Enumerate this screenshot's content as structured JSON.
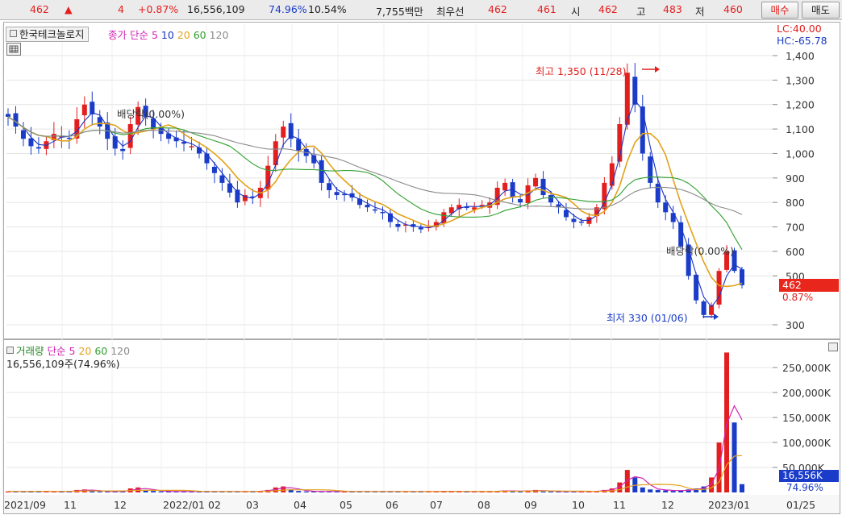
{
  "quote": {
    "price": "462",
    "arrow": "▲",
    "change": "4",
    "change_pct": "+0.87%",
    "volume": "16,556,109",
    "volume_ratio": "74.96%",
    "turnover": "10.54%",
    "amount": "7,755백만",
    "best_label": "최우선",
    "ask": "462",
    "bid": "461",
    "open_label": "시",
    "open": "462",
    "high_label": "고",
    "high": "483",
    "low_label": "저",
    "low": "460",
    "buy_label": "매수",
    "sell_label": "매도"
  },
  "price_panel": {
    "stock_name": "한국테크놀로지",
    "legend_prefix": "종가 단순",
    "ma_labels": [
      "5",
      "10",
      "20",
      "60",
      "120"
    ],
    "ma_colors": [
      "#1b35c4",
      "#e2a21a",
      "#2fa02f",
      "#8a8a8a"
    ],
    "lc_label": "LC:40.00",
    "hc_label": "HC:-65.78",
    "current_price": "462",
    "current_pct": "0.87%",
    "high_annotation": "최고 1,350 (11/28)",
    "low_annotation": "최저 330 (01/06)",
    "dividend_label_1": "배당락(0.00%)",
    "dividend_label_2": "배당락(0.00%)"
  },
  "volume_panel": {
    "legend_title": "거래량",
    "legend_prefix": "단순",
    "ma_labels": [
      "5",
      "20",
      "60",
      "120"
    ],
    "summary": "16,556,109주(74.96%)",
    "current_volume": "16,556K",
    "current_ratio": "74.96%"
  },
  "colors": {
    "up": "#e31e1e",
    "down": "#1a3cc8",
    "accent": "#e8261c"
  },
  "chart_data": [
    {
      "type": "candlestick",
      "title": "한국테크놀로지",
      "y_ticks": [
        "1,400",
        "1,300",
        "1,200",
        "1,100",
        "1,000",
        "900",
        "800",
        "700",
        "600",
        "500",
        "300"
      ],
      "ylim": [
        270,
        1420
      ],
      "x_ticks": [
        "2021/09",
        "11",
        "12",
        "2022/01",
        "02",
        "03",
        "04",
        "05",
        "06",
        "07",
        "08",
        "09",
        "10",
        "11",
        "12",
        "2023/01",
        "01/25"
      ],
      "close": [
        1150,
        1110,
        1060,
        1030,
        1020,
        1050,
        1080,
        1070,
        1060,
        1140,
        1200,
        1160,
        1110,
        1060,
        1020,
        1010,
        1120,
        1190,
        1150,
        1100,
        1080,
        1060,
        1050,
        1040,
        1030,
        1000,
        960,
        920,
        880,
        840,
        800,
        830,
        820,
        860,
        950,
        1050,
        1110,
        1060,
        1010,
        990,
        960,
        880,
        850,
        830,
        830,
        820,
        790,
        780,
        770,
        760,
        720,
        700,
        710,
        700,
        690,
        700,
        720,
        760,
        780,
        790,
        780,
        780,
        790,
        800,
        860,
        880,
        820,
        800,
        870,
        900,
        830,
        800,
        780,
        740,
        720,
        720,
        740,
        780,
        880,
        960,
        1120,
        1330,
        1200,
        1000,
        880,
        800,
        760,
        720,
        620,
        500,
        400,
        340,
        380,
        520,
        600,
        520,
        462
      ],
      "volume_k": [
        2,
        2,
        2,
        3,
        2,
        2,
        2,
        2,
        2,
        5,
        6,
        3,
        2,
        2,
        2,
        2,
        8,
        10,
        5,
        3,
        2,
        2,
        2,
        2,
        2,
        2,
        2,
        2,
        2,
        2,
        2,
        2,
        2,
        3,
        5,
        10,
        12,
        6,
        3,
        2,
        2,
        2,
        2,
        2,
        2,
        2,
        2,
        2,
        2,
        2,
        2,
        2,
        2,
        2,
        2,
        2,
        2,
        3,
        2,
        2,
        2,
        2,
        2,
        2,
        3,
        4,
        2,
        2,
        4,
        5,
        2,
        2,
        2,
        2,
        2,
        2,
        2,
        3,
        5,
        8,
        20,
        45,
        30,
        10,
        6,
        5,
        4,
        3,
        4,
        6,
        8,
        12,
        30,
        100,
        280,
        140,
        16.556
      ],
      "volume_ticks": [
        "250,000K",
        "200,000K",
        "150,000K",
        "100,000K",
        "50,000K"
      ]
    }
  ]
}
